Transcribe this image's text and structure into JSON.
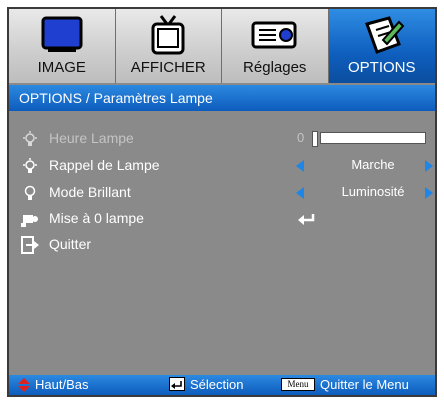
{
  "tabs": [
    {
      "label": "IMAGE",
      "icon": "monitor-icon",
      "active": false
    },
    {
      "label": "AFFICHER",
      "icon": "tv-icon",
      "active": false
    },
    {
      "label": "Réglages",
      "icon": "projector-icon",
      "active": false
    },
    {
      "label": "OPTIONS",
      "icon": "options-icon",
      "active": true
    }
  ],
  "title": "OPTIONS / Paramètres Lampe",
  "rows": {
    "lamp_hours": {
      "label": "Heure Lampe",
      "value": "0",
      "progress": 0
    },
    "lamp_reminder": {
      "label": "Rappel de Lampe",
      "value": "Marche"
    },
    "brightness_mode": {
      "label": "Mode Brillant",
      "value": "Luminosité"
    },
    "lamp_reset": {
      "label": "Mise à 0 lampe"
    },
    "exit": {
      "label": "Quitter"
    }
  },
  "footer": {
    "updown_label": "Haut/Bas",
    "select_label": "Sélection",
    "menu_key": "Menu",
    "quit_label": "Quitter le Menu"
  },
  "colors": {
    "accent": "#1d7be0",
    "panel": "#8a8a8a",
    "arrow": "#1d86e8"
  }
}
